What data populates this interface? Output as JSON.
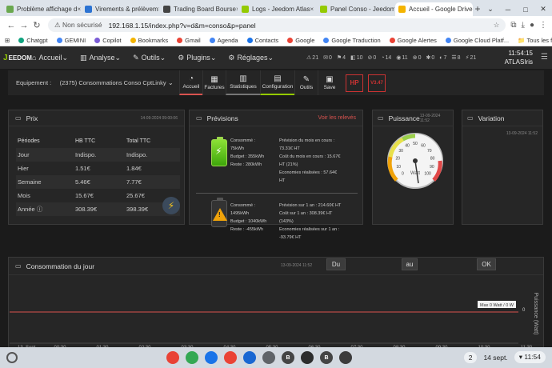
{
  "browser": {
    "tabs": [
      {
        "title": "Problème affichage d",
        "color": "#6aa84f"
      },
      {
        "title": "Virements & prélèvem",
        "color": "#2c73d2"
      },
      {
        "title": "Trading Board Bourse",
        "color": "#444444"
      },
      {
        "title": "Logs - Jeedom Atlas",
        "color": "#94ca02"
      },
      {
        "title": "Panel Conso - Jeedom",
        "color": "#94ca02"
      },
      {
        "title": "Accueil - Google Drive",
        "color": "#f4b400"
      }
    ],
    "active_tab": 5,
    "security": "Non sécurisé",
    "url": "192.168.1.15/index.php?v=d&m=conso&p=panel",
    "bookmarks": [
      {
        "label": "Chatgpt",
        "color": "#10a37f"
      },
      {
        "label": "GEMINI",
        "color": "#4285f4"
      },
      {
        "label": "Copilot",
        "color": "#7b5cd6"
      },
      {
        "label": "Bookmarks",
        "color": "#f4b400"
      },
      {
        "label": "Gmail",
        "color": "#ea4335"
      },
      {
        "label": "Agenda",
        "color": "#4285f4"
      },
      {
        "label": "Contacts",
        "color": "#1a73e8"
      },
      {
        "label": "Google",
        "color": "#ea4335"
      },
      {
        "label": "Google Traduction",
        "color": "#4285f4"
      },
      {
        "label": "Google Alertes",
        "color": "#ea4335"
      },
      {
        "label": "Google Cloud Platf...",
        "color": "#4285f4"
      }
    ],
    "bookmarks_right": "Tous les favoris"
  },
  "jeedom": {
    "logo": "EEDOM",
    "menu": [
      "Accueil",
      "Analyse",
      "Outils",
      "Plugins",
      "Réglages"
    ],
    "status": [
      "21",
      "0",
      "4",
      "10",
      "0",
      "14",
      "11",
      "0",
      "0",
      "7",
      "8",
      "21"
    ],
    "time": "11:54:15",
    "host": "ATLASIris"
  },
  "toolbar": {
    "equipement_label": "Equipement :",
    "equipement_value": "(2375) Consommations Conso CptLinky",
    "buttons": [
      "Accueil",
      "Factures",
      "Statistiques",
      "Configuration",
      "Outils",
      "Save"
    ],
    "hp": "HP",
    "version": "V3.47"
  },
  "prix": {
    "title": "Prix",
    "date": "14-09-2024 09:00:06",
    "headers": [
      "Périodes",
      "HB TTC",
      "Total TTC"
    ],
    "rows": [
      [
        "Jour",
        "Indispo.",
        "Indispo."
      ],
      [
        "Hier",
        "1.51€",
        "1.84€"
      ],
      [
        "Semaine",
        "5.46€",
        "7.77€"
      ],
      [
        "Mois",
        "15.67€",
        "25.67€"
      ],
      [
        "Année",
        "308.39€",
        "398.39€"
      ]
    ]
  },
  "previsions": {
    "title": "Prévisions",
    "link": "Voir les relevés",
    "mois_left": [
      "Consommé :",
      "75kWh",
      "Budget : 355kWh",
      "Reste : 280kWh"
    ],
    "mois_right": [
      "Prévision du mois en cours :",
      "73.31€ HT",
      "Coût du mois en cours : 15.67€",
      "HT (21%)",
      "Economies réalisées : 57.64€",
      "HT"
    ],
    "an_left": [
      "Consommé :",
      "1495kWh",
      "Budget : 1040kWh",
      "Reste : -455kWh"
    ],
    "an_right": [
      "Prévision sur 1 an : 214.60€ HT",
      "Coût sur 1 an : 308.39€ HT",
      "(143%)",
      "Economies réalisées sur 1 an :",
      "-93.79€ HT"
    ]
  },
  "puissance": {
    "title": "Puissance",
    "date": "13-09-2024 11:52",
    "unit": "Watt",
    "value": 0,
    "scale": [
      "0",
      "10",
      "20",
      "30",
      "40",
      "50",
      "60",
      "70",
      "80",
      "90",
      "100"
    ]
  },
  "variation": {
    "title": "Variation",
    "date": "13-09-2024 11:52"
  },
  "conso": {
    "title": "Consommation du jour",
    "date": "13-09-2024 11:52",
    "du": "Du",
    "au": "au",
    "ok": "OK",
    "legend": "Max 0 Watt / 0 W",
    "y_label": "Puissance (Watt)",
    "y_value": "0",
    "x_ticks": [
      "13. Sept",
      "00:30",
      "01:30",
      "02:30",
      "03:30",
      "04:30",
      "05:30",
      "06:30",
      "07:30",
      "08:30",
      "09:30",
      "10:30",
      "11:30"
    ]
  },
  "taskbar": {
    "date": "14 sept.",
    "time": "11:54",
    "notif": "2",
    "apps": [
      {
        "label": "",
        "color": "#e94235"
      },
      {
        "label": "",
        "color": "#34a853"
      },
      {
        "label": "",
        "color": "#1a73e8"
      },
      {
        "label": "",
        "color": "#ea4335"
      },
      {
        "label": "",
        "color": "#1967d2"
      },
      {
        "label": "",
        "color": "#5f6368"
      },
      {
        "label": "B",
        "color": "#444"
      },
      {
        "label": "",
        "color": "#2c2c2c"
      },
      {
        "label": "B",
        "color": "#444"
      },
      {
        "label": "",
        "color": "#3c3c3c"
      }
    ]
  }
}
